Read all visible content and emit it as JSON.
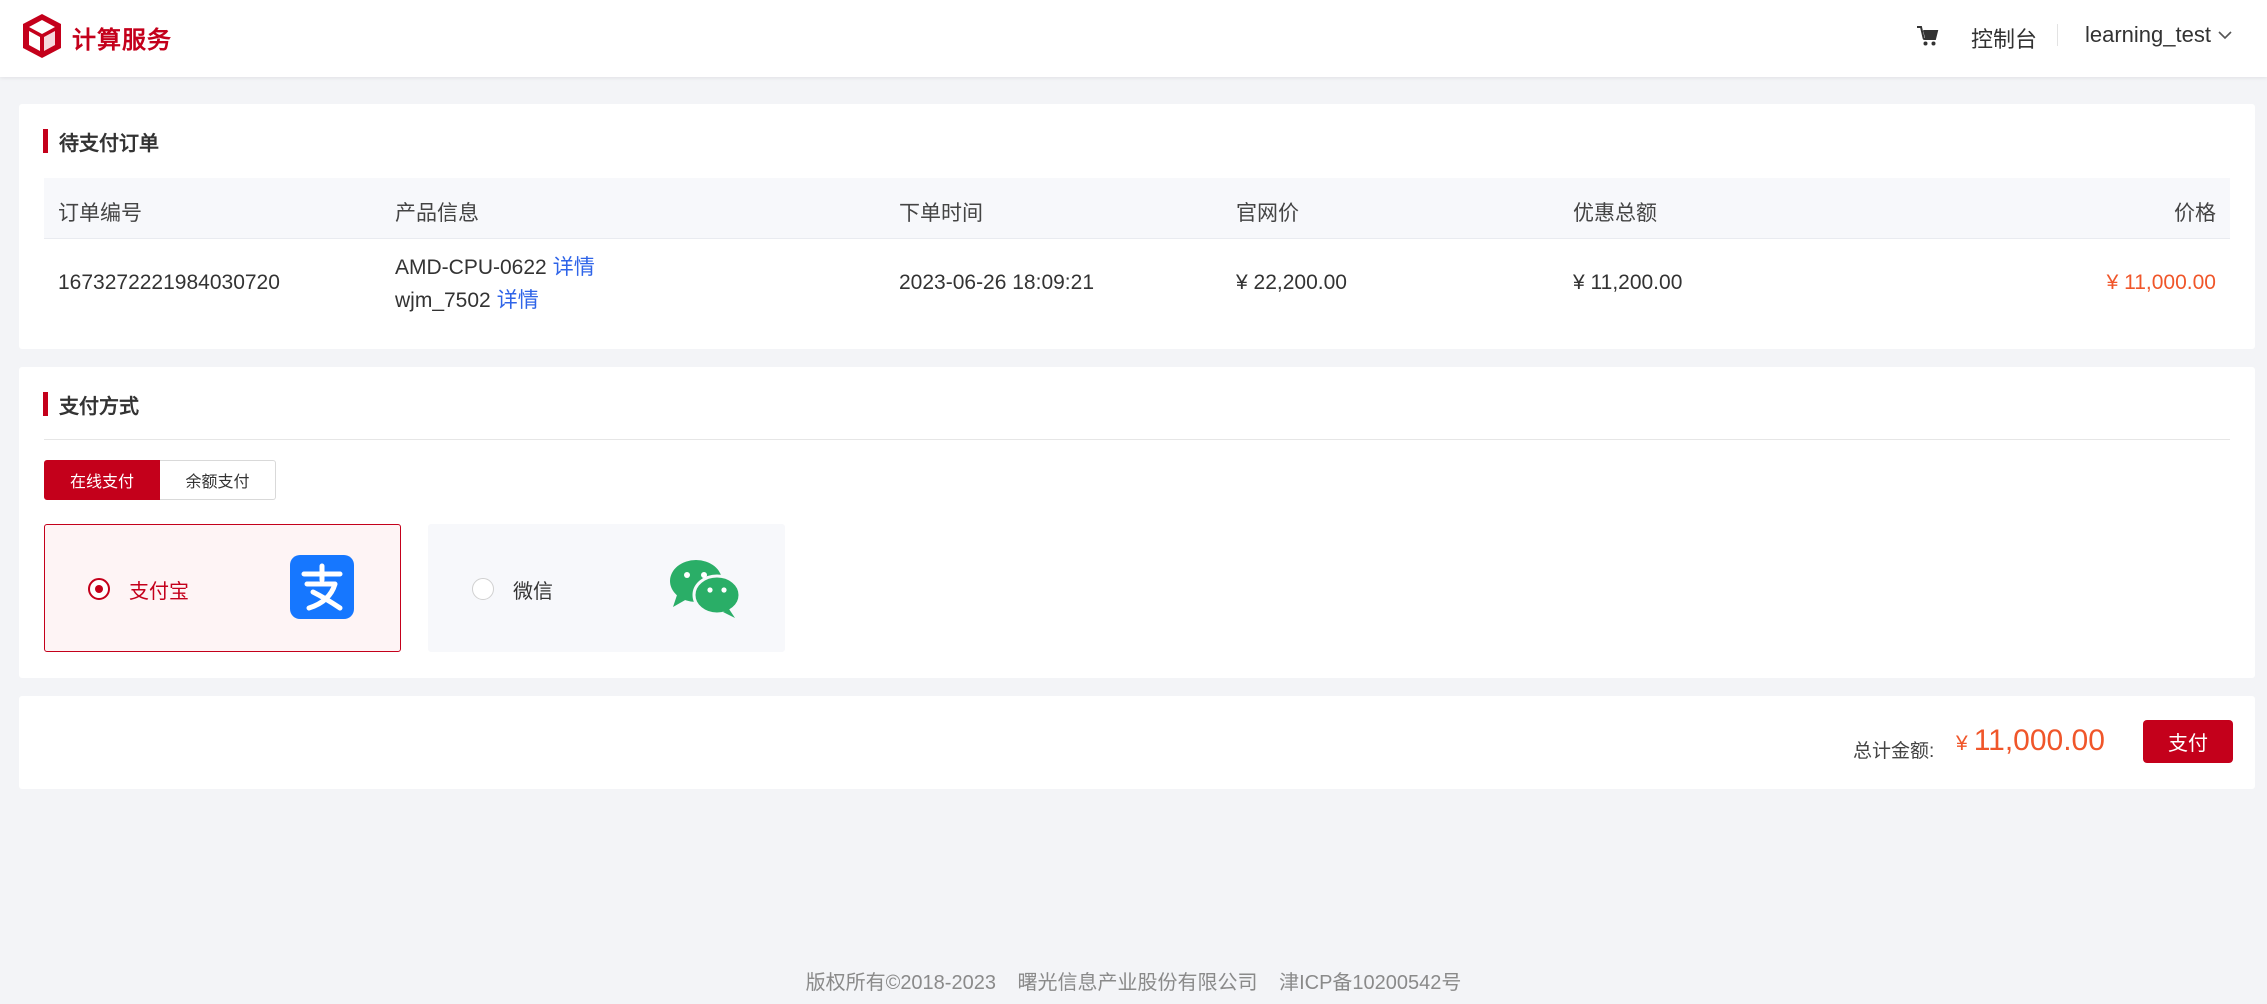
{
  "header": {
    "brand": "计算服务",
    "icons": {
      "logo": "cube-logo-icon",
      "cart": "cart-icon",
      "chevron": "chevron-down-icon"
    },
    "console": "控制台",
    "user": "learning_test"
  },
  "order": {
    "title": "待支付订单",
    "columns": [
      "订单编号",
      "产品信息",
      "下单时间",
      "官网价",
      "优惠总额",
      "价格"
    ],
    "row": {
      "order_id": "1673272221984030720",
      "products": [
        {
          "name": "AMD-CPU-0622",
          "link": "详情"
        },
        {
          "name": "wjm_7502",
          "link": "详情"
        }
      ],
      "order_time": "2023-06-26 18:09:21",
      "list_price": "¥ 22,200.00",
      "discount": "¥ 11,200.00",
      "price": "¥ 11,000.00"
    }
  },
  "payment": {
    "title": "支付方式",
    "tabs": [
      "在线支付",
      "余额支付"
    ],
    "options": [
      {
        "label": "支付宝",
        "icon": "alipay-icon",
        "selected": true
      },
      {
        "label": "微信",
        "icon": "wechat-icon",
        "selected": false
      }
    ]
  },
  "total": {
    "label": "总计金额:",
    "currency": "¥",
    "amount": "11,000.00",
    "pay_button": "支付"
  },
  "footer": {
    "copyright": "版权所有©2018-2023",
    "company": "曙光信息产业股份有限公司",
    "icp": "津ICP备10200542号"
  },
  "colors": {
    "brand": "#c4001b",
    "price": "#f0562a",
    "link": "#2f64e8",
    "alipay": "#1677ff",
    "wechat": "#2aae67"
  }
}
